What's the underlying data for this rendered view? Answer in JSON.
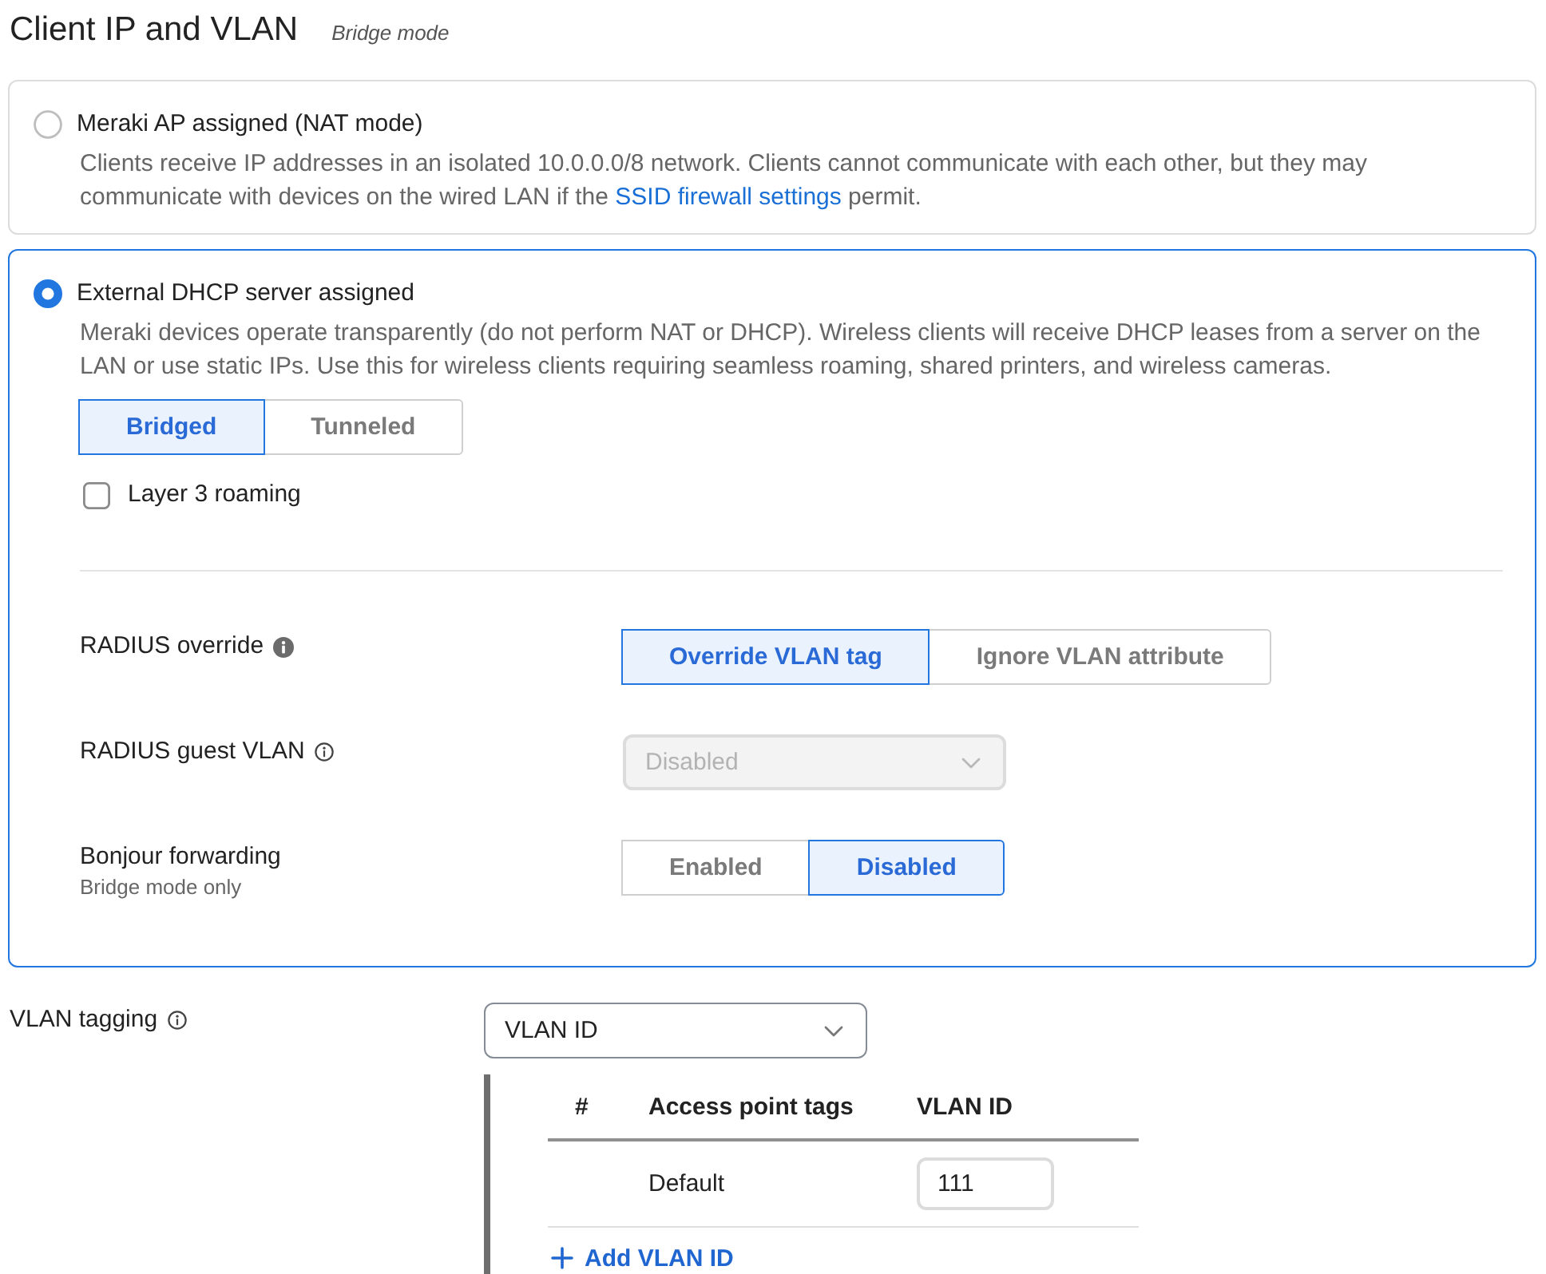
{
  "header": {
    "title": "Client IP and VLAN",
    "subtitle": "Bridge mode"
  },
  "ip_options": [
    {
      "label": "Meraki AP assigned (NAT mode)",
      "selected": false,
      "description": [
        {
          "kind": "text",
          "text": "Clients receive IP addresses in an isolated 10.0.0.0/8 network. Clients cannot communicate with each other, but they may communicate with devices on the wired LAN if the "
        },
        {
          "kind": "link",
          "text": "SSID firewall settings"
        },
        {
          "kind": "text",
          "text": " permit."
        }
      ]
    },
    {
      "label": "External DHCP server assigned",
      "selected": true,
      "description": [
        {
          "kind": "text",
          "text": "Meraki devices operate transparently (do not perform NAT or DHCP). Wireless clients will receive DHCP leases from a server on the LAN or use static IPs. Use this for wireless clients requiring seamless roaming, shared printers, and wireless cameras."
        }
      ],
      "mode": [
        {
          "label": "Bridged",
          "selected": true
        },
        {
          "label": "Tunneled",
          "selected": false
        }
      ],
      "layer3_roaming": {
        "label": "Layer 3 roaming",
        "checked": false
      },
      "settings": [
        {
          "kind": "segmented",
          "label": "RADIUS override",
          "info_icon": {
            "filled": true
          },
          "options": [
            {
              "label": "Override VLAN tag",
              "selected": true
            },
            {
              "label": "Ignore VLAN attribute",
              "selected": false
            }
          ]
        },
        {
          "kind": "select",
          "label": "RADIUS guest VLAN",
          "info_icon": {
            "filled": false
          },
          "value": "Disabled",
          "disabled": true
        },
        {
          "kind": "segmented",
          "label": "Bonjour forwarding",
          "hint": "Bridge mode only",
          "options": [
            {
              "label": "Enabled",
              "selected": false
            },
            {
              "label": "Disabled",
              "selected": true
            }
          ]
        }
      ]
    }
  ],
  "vlan_tagging": {
    "label": "VLAN tagging",
    "info_icon": {
      "filled": false
    },
    "select": {
      "value": "VLAN ID",
      "disabled": false
    },
    "table": {
      "columns": [
        "#",
        "Access point tags",
        "VLAN ID"
      ],
      "rows": [
        {
          "access_point_tags": "Default",
          "vlan_id": "111"
        }
      ]
    },
    "add_button": "Add VLAN ID"
  }
}
